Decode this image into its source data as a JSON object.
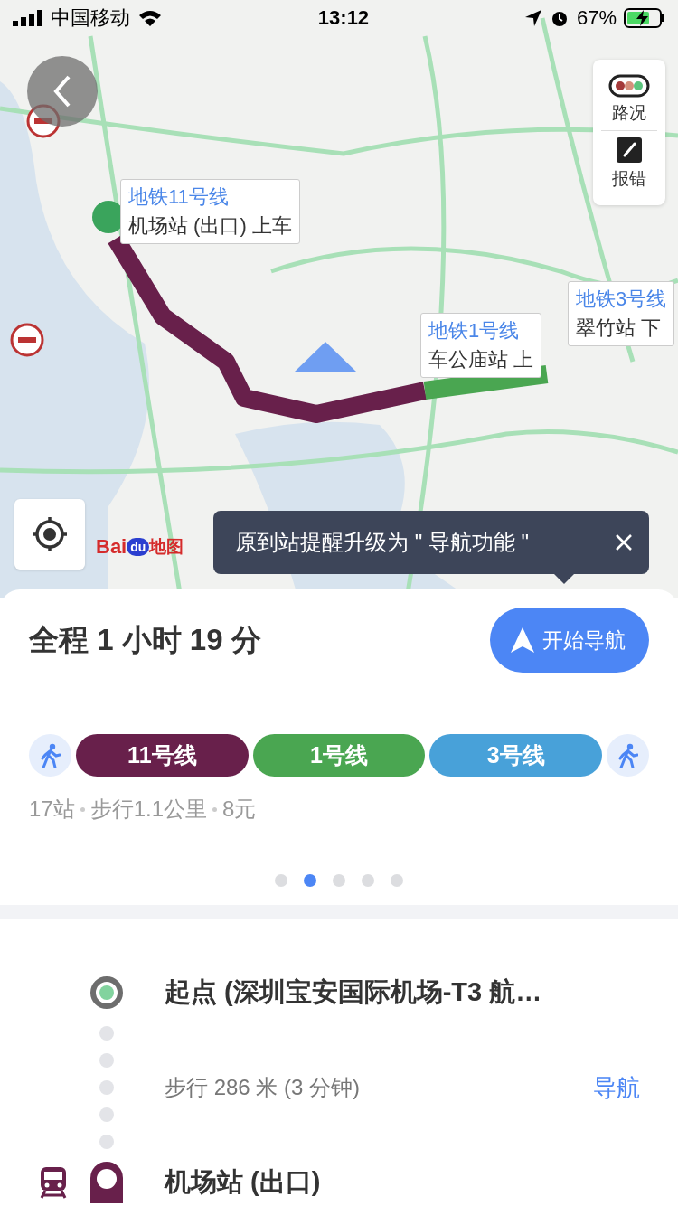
{
  "status_bar": {
    "carrier": "中国移动",
    "time": "13:12",
    "battery": "67%"
  },
  "map": {
    "callouts": [
      {
        "line": "地铁11号线",
        "text": "机场站 (出口) 上车"
      },
      {
        "line": "地铁1号线",
        "text": "车公庙站 上"
      },
      {
        "line": "地铁3号线",
        "text": "翠竹站 下"
      }
    ],
    "side_tools": [
      {
        "kind": "traffic",
        "label": "路况"
      },
      {
        "kind": "report",
        "label": "报错"
      }
    ],
    "logo": {
      "left": "Bai",
      "mid": "du",
      "right": "地图"
    },
    "toast": {
      "text": "原到站提醒升级为 \" 导航功能 \""
    }
  },
  "summary": {
    "title": "全程 1 小时 19 分",
    "start_button": "开始导航",
    "segments": [
      {
        "kind": "walk"
      },
      {
        "kind": "line",
        "label": "11号线",
        "color": "#68204b"
      },
      {
        "kind": "line",
        "label": "1号线",
        "color": "#4aa651"
      },
      {
        "kind": "line",
        "label": "3号线",
        "color": "#48a1d9"
      },
      {
        "kind": "walk"
      }
    ],
    "info": [
      "17站",
      "步行1.1公里",
      "8元"
    ],
    "pages": [
      {
        "selected": false
      },
      {
        "selected": true
      },
      {
        "selected": false
      },
      {
        "selected": false
      },
      {
        "selected": false
      }
    ]
  },
  "steps": [
    {
      "kind": "start",
      "title": "起点 (深圳宝安国际机场-T3 航…"
    },
    {
      "kind": "walk",
      "text": "步行 286 米 (3 分钟)",
      "action": "导航"
    },
    {
      "kind": "station",
      "title": "机场站 (出口)",
      "color": "#68204b"
    }
  ]
}
